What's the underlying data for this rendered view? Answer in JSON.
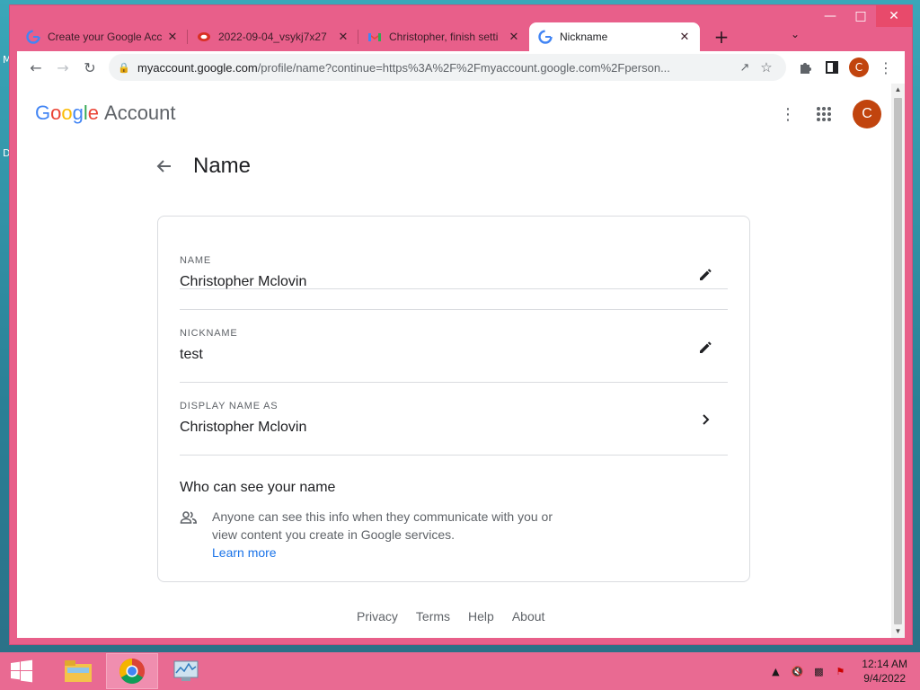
{
  "desktop": {
    "letters": [
      "M",
      "D"
    ]
  },
  "tabs": [
    {
      "title": "Create your Google Acc",
      "favicon": "google-g-icon"
    },
    {
      "title": "2022-09-04_vsykj7x27",
      "favicon": "recording-icon"
    },
    {
      "title": "Christopher, finish setti",
      "favicon": "gmail-icon"
    },
    {
      "title": "Nickname",
      "favicon": "google-g-icon",
      "active": true
    }
  ],
  "toolbar": {
    "url_domain": "myaccount.google.com",
    "url_rest": "/profile/name?continue=https%3A%2F%2Fmyaccount.google.com%2Fperson...",
    "profile_initial": "C"
  },
  "header": {
    "logo_letters": [
      "G",
      "o",
      "o",
      "g",
      "l",
      "e"
    ],
    "logo_colors": [
      "#4285F4",
      "#EA4335",
      "#FBBC05",
      "#4285F4",
      "#34A853",
      "#EA4335"
    ],
    "account_label": "Account",
    "avatar_initial": "C"
  },
  "page": {
    "title": "Name"
  },
  "card": {
    "rows": [
      {
        "label": "NAME",
        "value": "Christopher Mclovin",
        "action": "edit"
      },
      {
        "label": "NICKNAME",
        "value": "test",
        "action": "edit"
      },
      {
        "label": "DISPLAY NAME AS",
        "value": "Christopher Mclovin",
        "action": "open"
      }
    ],
    "who": {
      "title": "Who can see your name",
      "text": "Anyone can see this info when they communicate with you or view content you create in Google services.",
      "link": "Learn more"
    }
  },
  "footer": {
    "links": [
      "Privacy",
      "Terms",
      "Help",
      "About"
    ]
  },
  "taskbar": {
    "time": "12:14 AM",
    "date": "9/4/2022"
  },
  "colors": {
    "window_frame": "#e85f8a",
    "avatar": "#c1440e",
    "link": "#1a73e8"
  }
}
